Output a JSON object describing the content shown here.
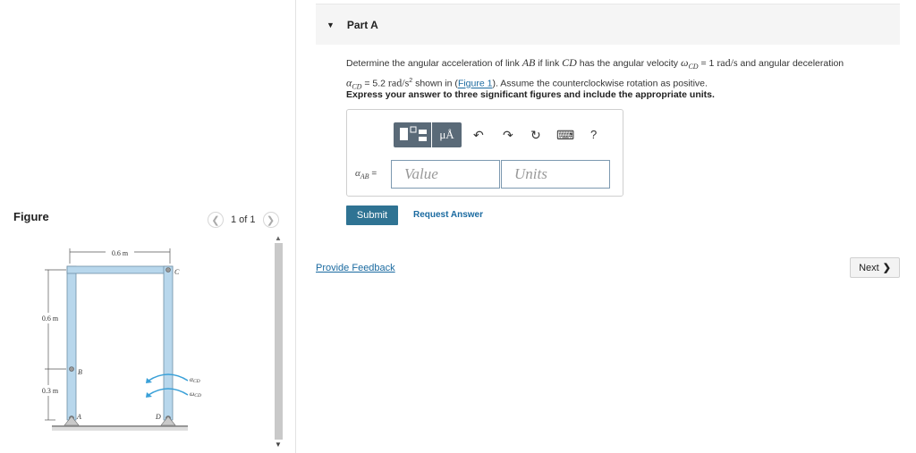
{
  "figure": {
    "title": "Figure",
    "pager_text": "1 of 1",
    "dims": {
      "top": "0.6 m",
      "left_upper": "0.6 m",
      "left_lower": "0.3 m"
    },
    "points": {
      "a": "A",
      "b": "B",
      "c": "C",
      "d": "D"
    },
    "labels": {
      "alpha": "α",
      "alpha_sub": "CD",
      "omega": "ω",
      "omega_sub": "CD"
    }
  },
  "part": {
    "title": "Part A"
  },
  "problem": {
    "t1": "Determine the angular acceleration of link ",
    "AB": "AB",
    "t2": " if link ",
    "CD": "CD",
    "t3": " has the angular velocity ",
    "omega_sym": "ω",
    "omega_sub": "CD",
    "t4": " = 1 ",
    "omega_unit": "rad/s",
    "t5": " and angular deceleration",
    "alpha_sym": "α",
    "alpha_sub": "CD",
    "t6": " = 5.2 ",
    "alpha_unit": "rad/s",
    "alpha_exp": "2",
    "t7": " shown in (",
    "figure_link": "Figure 1",
    "t8": "). Assume the counterclockwise rotation as positive."
  },
  "instruction": "Express your answer to three significant figures and include the appropriate units.",
  "answer": {
    "label_sym": "α",
    "label_sub": "AB",
    "label_eq": " =",
    "value_placeholder": "Value",
    "units_placeholder": "Units"
  },
  "toolbar": {
    "mu_label": "μÅ",
    "undo_icon": "↶",
    "redo_icon": "↷",
    "reset_icon": "↻",
    "keyboard_icon": "⌨",
    "help_label": "?"
  },
  "actions": {
    "submit": "Submit",
    "request": "Request Answer",
    "feedback": "Provide Feedback",
    "next": "Next"
  },
  "colors": {
    "accent": "#2f7393",
    "link": "#1a6aa0",
    "frame": "#b8d7ec",
    "arrow": "#3aa0d8"
  }
}
